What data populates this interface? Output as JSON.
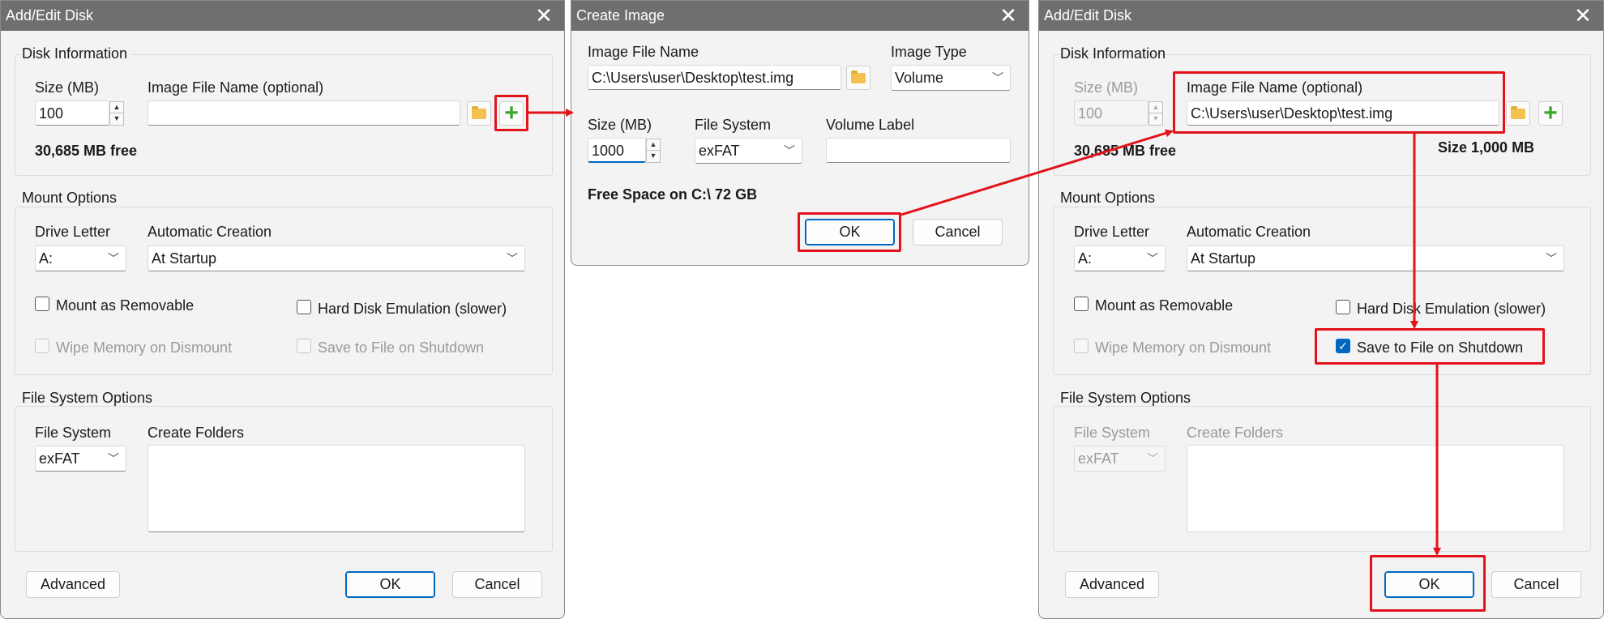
{
  "left_dialog": {
    "title": "Add/Edit Disk",
    "disk_info": {
      "group_label": "Disk Information",
      "size_label": "Size (MB)",
      "size_value": "100",
      "image_label": "Image File Name (optional)",
      "image_value": "",
      "free_text": "30,685 MB free"
    },
    "mount": {
      "group_label": "Mount Options",
      "drive_letter_label": "Drive Letter",
      "drive_letter_value": "A:",
      "auto_label": "Automatic Creation",
      "auto_value": "At Startup",
      "removable": "Mount as Removable",
      "hdd_emulation": "Hard Disk Emulation (slower)",
      "wipe": "Wipe Memory on Dismount",
      "save_shutdown": "Save to File on Shutdown"
    },
    "fs": {
      "group_label": "File System Options",
      "fs_label": "File System",
      "fs_value": "exFAT",
      "folders_label": "Create Folders"
    },
    "buttons": {
      "advanced": "Advanced",
      "ok": "OK",
      "cancel": "Cancel"
    }
  },
  "middle_dialog": {
    "title": "Create Image",
    "image_name_label": "Image File Name",
    "image_name_value": "C:\\Users\\user\\Desktop\\test.img",
    "image_type_label": "Image Type",
    "image_type_value": "Volume",
    "size_label": "Size (MB)",
    "size_value": "1000",
    "fs_label": "File System",
    "fs_value": "exFAT",
    "volume_label": "Volume Label",
    "volume_value": "",
    "free_text": "Free Space on C:\\ 72 GB",
    "buttons": {
      "ok": "OK",
      "cancel": "Cancel"
    }
  },
  "right_dialog": {
    "title": "Add/Edit Disk",
    "disk_info": {
      "group_label": "Disk Information",
      "size_label": "Size (MB)",
      "size_value": "100",
      "image_label": "Image File Name (optional)",
      "image_value": "C:\\Users\\user\\Desktop\\test.img",
      "free_text": "30,685 MB free",
      "image_size_text": "Size 1,000 MB"
    },
    "mount": {
      "group_label": "Mount Options",
      "drive_letter_label": "Drive Letter",
      "drive_letter_value": "A:",
      "auto_label": "Automatic Creation",
      "auto_value": "At Startup",
      "removable": "Mount as Removable",
      "hdd_emulation": "Hard Disk Emulation (slower)",
      "wipe": "Wipe Memory on Dismount",
      "save_shutdown": "Save to File on Shutdown"
    },
    "fs": {
      "group_label": "File System Options",
      "fs_label": "File System",
      "fs_value": "exFAT",
      "folders_label": "Create Folders"
    },
    "buttons": {
      "advanced": "Advanced",
      "ok": "OK",
      "cancel": "Cancel"
    }
  },
  "icons": {
    "close": "close-icon",
    "folder": "folder-icon",
    "plus": "plus-icon",
    "chevron": "chevron-down-icon",
    "check": "checkmark-icon"
  },
  "colors": {
    "titlebar": "#6f6f6f",
    "highlight": "#e3121b",
    "accent": "#0067c0",
    "plus": "#3aa52a"
  }
}
